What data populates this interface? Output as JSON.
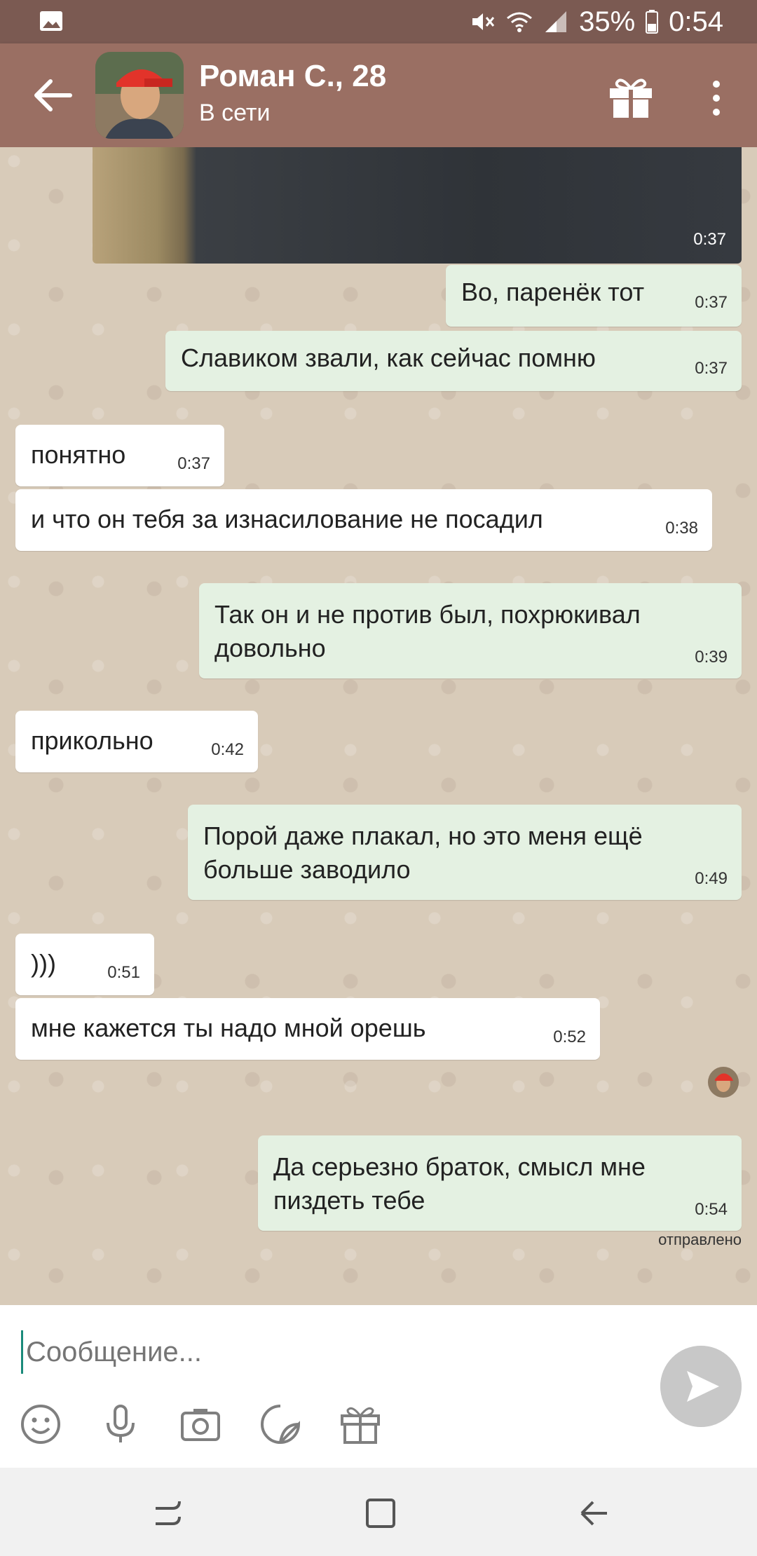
{
  "status_bar": {
    "battery": "35%",
    "time": "0:54",
    "icons": [
      "image-icon",
      "mute-icon",
      "wifi-icon",
      "signal-icon",
      "battery-icon"
    ]
  },
  "header": {
    "back_icon": "arrow-left-icon",
    "contact_name": "Роман С., 28",
    "contact_status": "В сети",
    "gift_icon": "gift-icon",
    "more_icon": "more-vertical-icon"
  },
  "chat": {
    "photo_time": "0:37",
    "messages": [
      {
        "dir": "out",
        "text": "Во, паренёк тот",
        "time": "0:37"
      },
      {
        "dir": "out",
        "text": "Славиком звали, как сейчас помню",
        "time": "0:37"
      },
      {
        "dir": "in",
        "text": "понятно",
        "time": "0:37"
      },
      {
        "dir": "in",
        "text": "и что он тебя за изнасилование не посадил",
        "time": "0:38"
      },
      {
        "dir": "out",
        "text": "Так он и не против был, похрюкивал",
        "text2": "довольно",
        "time": "0:39"
      },
      {
        "dir": "in",
        "text": "прикольно",
        "time": "0:42"
      },
      {
        "dir": "out",
        "text": "Порой даже плакал, но это меня ещё",
        "text2": "больше заводило",
        "time": "0:49"
      },
      {
        "dir": "in",
        "text": ")))",
        "time": "0:51"
      },
      {
        "dir": "in",
        "text": "мне кажется ты надо мной орешь",
        "time": "0:52"
      },
      {
        "dir": "out",
        "text": "Да серьезно браток, смысл мне",
        "text2": "пиздеть тебе",
        "time": "0:54"
      }
    ],
    "sent_status": "отправлено"
  },
  "composer": {
    "placeholder": "Сообщение...",
    "tools": [
      "emoji-icon",
      "microphone-icon",
      "camera-icon",
      "sticker-icon",
      "gift-icon"
    ],
    "send_icon": "send-icon"
  },
  "colors": {
    "status_bar": "#7b5a52",
    "app_bar": "#9a6f63",
    "outgoing_bubble": "#e4f1e2",
    "incoming_bubble": "#ffffff",
    "chat_bg": "#d8cbb9"
  }
}
